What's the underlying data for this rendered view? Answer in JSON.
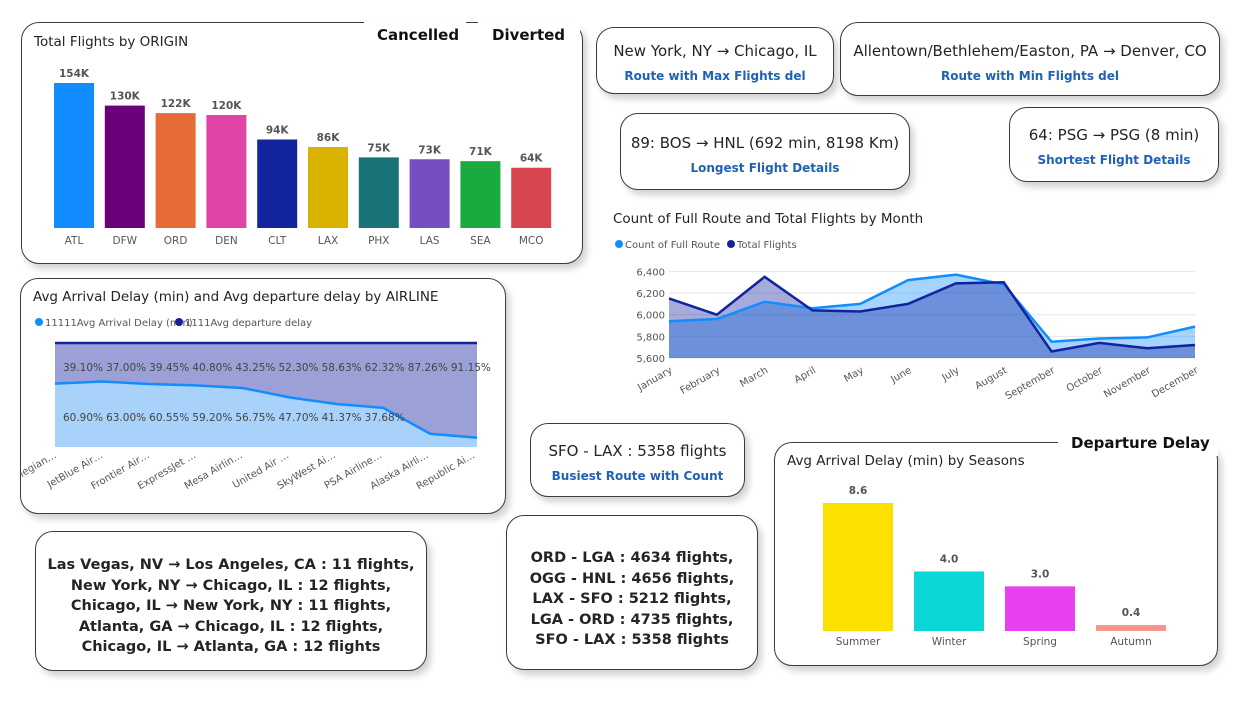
{
  "buttons": {
    "cancelled": "Cancelled",
    "diverted": "Diverted",
    "departure_delay": "Departure Delay"
  },
  "kpis": {
    "max_route": {
      "value": "New York, NY → Chicago, IL",
      "label": "Route with Max Flights del"
    },
    "min_route": {
      "value": "Allentown/Bethlehem/Easton, PA → Denver, CO",
      "label": "Route with Min Flights del"
    },
    "longest": {
      "value": "89: BOS → HNL (692 min, 8198 Km)",
      "label": "Longest Flight Details"
    },
    "shortest": {
      "value": "64: PSG → PSG (8 min)",
      "label": "Shortest Flight Details"
    },
    "busiest": {
      "value": "SFO - LAX : 5358 flights",
      "label": "Busiest Route with Count"
    }
  },
  "route_list": [
    "Las Vegas, NV → Los Angeles, CA : 11 flights,",
    "New York, NY → Chicago, IL : 12 flights,",
    "Chicago, IL → New York, NY : 11 flights,",
    "Atlanta, GA → Chicago, IL : 12 flights,",
    "Chicago, IL → Atlanta, GA : 12 flights"
  ],
  "pair_list": [
    "ORD - LGA : 4634 flights,",
    "OGG - HNL : 4656 flights,",
    "LAX - SFO : 5212 flights,",
    "LGA - ORD : 4735 flights,",
    "SFO - LAX : 5358 flights"
  ],
  "chart_data": [
    {
      "type": "bar",
      "title": "Total Flights by ORIGIN",
      "categories": [
        "ATL",
        "DFW",
        "ORD",
        "DEN",
        "CLT",
        "LAX",
        "PHX",
        "LAS",
        "SEA",
        "MCO"
      ],
      "values": [
        154,
        130,
        122,
        120,
        94,
        86,
        75,
        73,
        71,
        64
      ],
      "data_labels": [
        "154K",
        "130K",
        "122K",
        "120K",
        "94K",
        "86K",
        "75K",
        "73K",
        "71K",
        "64K"
      ],
      "colors": [
        "#118dff",
        "#6b007b",
        "#e66c37",
        "#e044a7",
        "#12239e",
        "#d9b300",
        "#197278",
        "#744ec2",
        "#1aab40",
        "#d64550"
      ],
      "ylim": [
        0,
        160
      ]
    },
    {
      "type": "area",
      "title": "Avg Arrival Delay (min) and Avg departure delay by AIRLINE",
      "legend": [
        "11111Avg Arrival Delay (min)",
        "1111Avg departure delay"
      ],
      "legend_colors": [
        "#118dff",
        "#12239e"
      ],
      "legend_position": "top-left",
      "categories": [
        "Allegian…",
        "JetBlue Air…",
        "Frontier Air…",
        "ExpressJet …",
        "Mesa Airlin…",
        "United Air …",
        "SkyWest Ai…",
        "PSA Airline…",
        "Alaska Airli…",
        "Republic Ai…"
      ],
      "series": [
        {
          "name": "11111Avg Arrival Delay (min)",
          "values": [
            60.9,
            63.0,
            60.55,
            59.2,
            56.75,
            47.7,
            41.37,
            37.68,
            12.74,
            8.85
          ],
          "labels": [
            "60.90%",
            "63.00%",
            "60.55%",
            "59.20%",
            "56.75%",
            "47.70%",
            "41.37%",
            "37.68%",
            "",
            ""
          ]
        },
        {
          "name": "1111Avg departure delay",
          "values": [
            39.1,
            37.0,
            39.45,
            40.8,
            43.25,
            52.3,
            58.63,
            62.32,
            87.26,
            91.15
          ],
          "labels": [
            "39.10%",
            "37.00%",
            "39.45%",
            "40.80%",
            "43.25%",
            "52.30%",
            "58.63%",
            "62.32%",
            "87.26%",
            "91.15%"
          ]
        }
      ],
      "stacked": true,
      "ylim": [
        0,
        100
      ]
    },
    {
      "type": "area",
      "title": "Count of Full Route and Total Flights by Month",
      "legend": [
        "Count of Full Route",
        "Total Flights"
      ],
      "legend_colors": [
        "#118dff",
        "#12239e"
      ],
      "legend_position": "top-left",
      "x": [
        "January",
        "February",
        "March",
        "April",
        "May",
        "June",
        "July",
        "August",
        "September",
        "October",
        "November",
        "December"
      ],
      "series": [
        {
          "name": "Count of Full Route",
          "values": [
            5940,
            5960,
            6120,
            6060,
            6100,
            6320,
            6370,
            6280,
            5750,
            5780,
            5790,
            5890
          ]
        },
        {
          "name": "Total Flights",
          "values": [
            6150,
            6000,
            6350,
            6040,
            6030,
            6100,
            6290,
            6300,
            5660,
            5740,
            5690,
            5720
          ]
        }
      ],
      "yticks": [
        "5,600",
        "5,800",
        "6,000",
        "6,200",
        "6,400"
      ],
      "ylim": [
        5600,
        6450
      ]
    },
    {
      "type": "bar",
      "title": "Avg Arrival Delay (min) by Seasons",
      "categories": [
        "Summer",
        "Winter",
        "Spring",
        "Autumn"
      ],
      "values": [
        8.6,
        4.0,
        3.0,
        0.4
      ],
      "data_labels": [
        "8.6",
        "4.0",
        "3.0",
        "0.4"
      ],
      "colors": [
        "#fce100",
        "#0ad6d6",
        "#e83ff0",
        "#f7958a"
      ],
      "ylim": [
        0,
        8.6
      ]
    }
  ]
}
